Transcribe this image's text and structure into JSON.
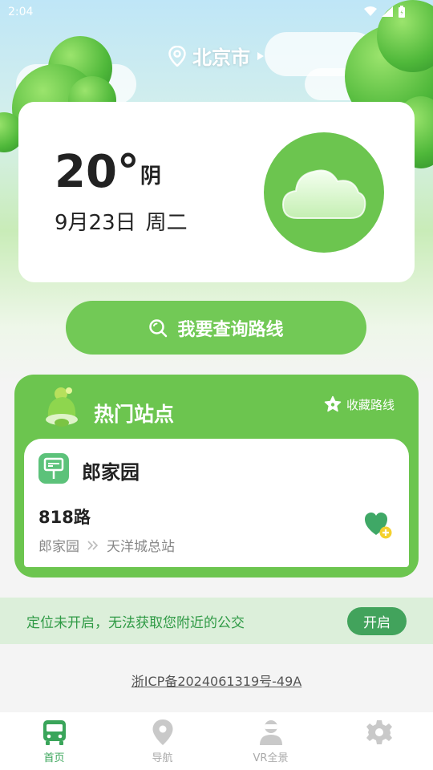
{
  "status_bar": {
    "time": "2:04"
  },
  "location": {
    "city": "北京市"
  },
  "weather": {
    "temperature": "20°",
    "condition": "阴",
    "date": "9月23日",
    "weekday": "周二",
    "icon": "cloud-icon"
  },
  "query": {
    "label": "我要查询路线",
    "icon": "search-icon"
  },
  "hot": {
    "title": "热门站点",
    "fav_label": "收藏路线",
    "station": {
      "name": "郎家园",
      "route": "818路",
      "from": "郎家园",
      "to": "天洋城总站"
    }
  },
  "notice": {
    "text": "定位未开启，无法获取您附近的公交",
    "button": "开启"
  },
  "icp": "浙ICP备2024061319号-49A",
  "nav": [
    {
      "label": "首页",
      "icon": "bus-icon"
    },
    {
      "label": "导航",
      "icon": "location-pin-icon"
    },
    {
      "label": "VR全景",
      "icon": "vr-person-icon"
    },
    {
      "label": "",
      "icon": "gear-icon"
    }
  ],
  "colors": {
    "accent": "#6cc54f",
    "accent_dark": "#3aa55a",
    "notice_bg": "#dcefda"
  }
}
